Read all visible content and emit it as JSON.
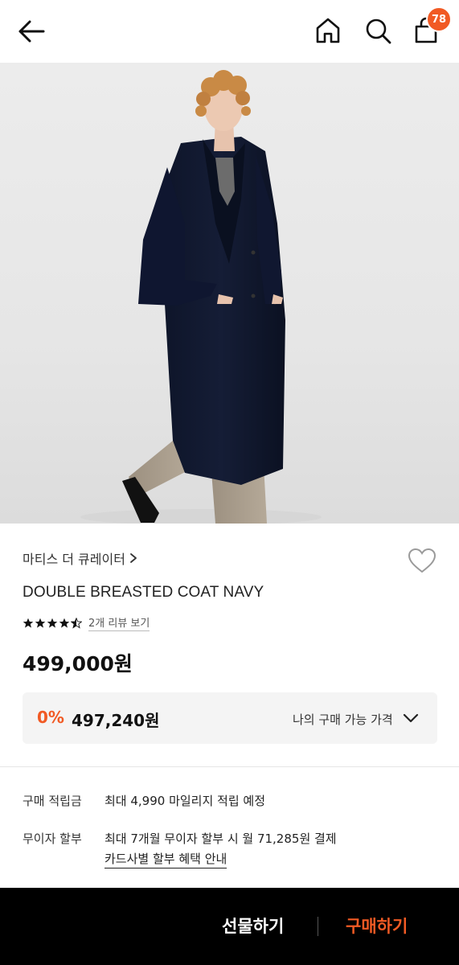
{
  "header": {
    "cart_count": "78",
    "accent_color": "#f15a24"
  },
  "product": {
    "brand": "마티스 더 큐레이터",
    "name": "DOUBLE BREASTED COAT NAVY",
    "rating": 4.5,
    "review_link": "2개 리뷰 보기",
    "price": "499,000원"
  },
  "price_box": {
    "discount_rate": "0%",
    "discounted_price": "497,240원",
    "label": "나의 구매 가능 가격"
  },
  "benefits": [
    {
      "label": "구매 적립금",
      "value": "최대 4,990 마일리지 적립 예정"
    },
    {
      "label": "무이자 할부",
      "value": "최대 7개월 무이자 할부 시 월 71,285원 결제",
      "link": "카드사별 할부 혜택 안내"
    }
  ],
  "footer": {
    "gift_label": "선물하기",
    "buy_label": "구매하기"
  },
  "icons": [
    "back-arrow-icon",
    "home-icon",
    "search-icon",
    "shopping-bag-icon",
    "heart-icon",
    "share-icon",
    "chevron-right-icon",
    "chevron-down-icon",
    "star-icon"
  ]
}
